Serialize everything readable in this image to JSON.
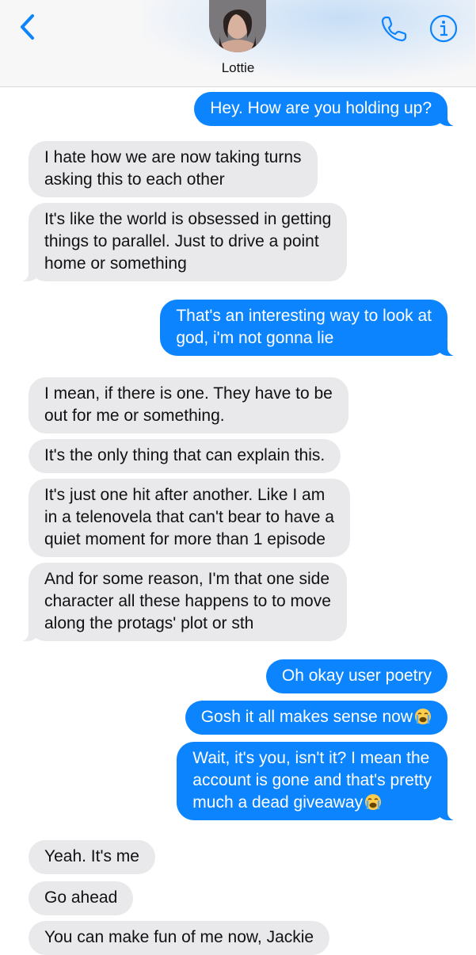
{
  "header": {
    "contact_name": "Lottie",
    "accent_color": "#0b84fe"
  },
  "icons": {
    "back": "chevron-left-icon",
    "avatar": "contact-photo",
    "call": "phone-icon",
    "info": "info-icon",
    "emoji": "loudly-crying-face-emoji"
  },
  "messages": [
    {
      "from": "me",
      "text": "Hey. How are you holding up?"
    },
    {
      "from": "them",
      "lines": [
        "I hate how we are now taking turns",
        "asking this to each other"
      ]
    },
    {
      "from": "them",
      "lines": [
        "It's like the world is obsessed in getting",
        "things to parallel. Just to drive a point",
        "home or something"
      ]
    },
    {
      "from": "me",
      "lines": [
        "That's an interesting way to look at",
        "god, i'm not gonna lie"
      ]
    },
    {
      "from": "them",
      "lines": [
        "I mean, if there is one. They have to be",
        "out for me or something."
      ]
    },
    {
      "from": "them",
      "text": "It's the only thing that can explain this."
    },
    {
      "from": "them",
      "lines": [
        "It's just one hit after another. Like I am",
        "in a telenovela that can't bear to have a",
        "quiet moment for more than 1 episode"
      ]
    },
    {
      "from": "them",
      "lines": [
        "And for some reason, I'm that one side",
        "character all these happens to to move",
        "along the protags' plot or sth"
      ]
    },
    {
      "from": "me",
      "text": "Oh okay user poetry"
    },
    {
      "from": "me",
      "text": "Gosh it all makes sense now",
      "emoji": "😭"
    },
    {
      "from": "me",
      "lines": [
        "Wait, it's you, isn't it? I mean the",
        "account is gone and that's pretty",
        "much a dead giveaway"
      ],
      "emoji": "😭"
    },
    {
      "from": "them",
      "text": "Yeah. It's me"
    },
    {
      "from": "them",
      "text": "Go ahead"
    },
    {
      "from": "them",
      "text": "You can make fun of me now, Jackie"
    }
  ]
}
